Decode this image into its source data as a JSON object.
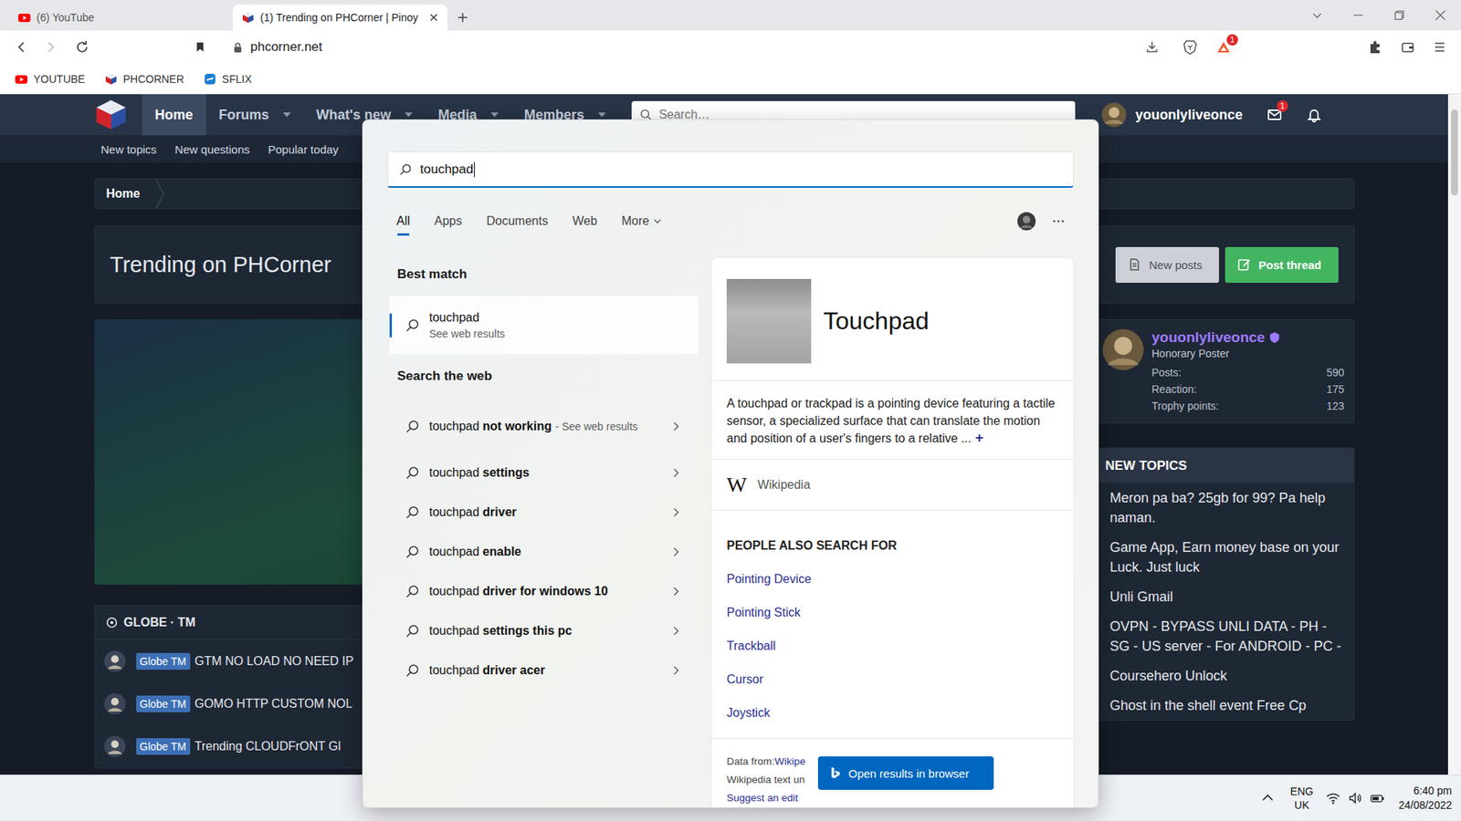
{
  "browser": {
    "tabs": [
      {
        "label": "(6) YouTube",
        "selected": false,
        "kind": "youtube"
      },
      {
        "label": "(1) Trending on PHCorner | Pinoy",
        "selected": true,
        "kind": "phcorner"
      }
    ],
    "forward_enabled": false,
    "url": "phcorner.net",
    "rewards_badge": "1",
    "bookmarks": [
      {
        "label": "YOUTUBE",
        "kind": "youtube"
      },
      {
        "label": "PHCORNER",
        "kind": "phcorner"
      },
      {
        "label": "SFLIX",
        "kind": "sflix"
      }
    ]
  },
  "site": {
    "nav": [
      {
        "label": "Home",
        "selected": true,
        "dropdown": false
      },
      {
        "label": "Forums",
        "selected": false,
        "dropdown": true
      },
      {
        "label": "What's new",
        "selected": false,
        "dropdown": true
      },
      {
        "label": "Media",
        "selected": false,
        "dropdown": true
      },
      {
        "label": "Members",
        "selected": false,
        "dropdown": true
      }
    ],
    "search_placeholder": "Search…",
    "user": "youonlyliveonce",
    "mail_badge": "1",
    "subnav": [
      "New topics",
      "New questions",
      "Popular today"
    ],
    "breadcrumb": "Home",
    "page_title": "Trending on PHCorner",
    "actions": [
      {
        "label": "New posts",
        "kind": "secondary"
      },
      {
        "label": "Post thread",
        "kind": "primary"
      }
    ],
    "section": {
      "title": "GLOBE · TM",
      "threads": [
        {
          "tag": "Globe TM",
          "title": "GTM NO LOAD NO NEED IP"
        },
        {
          "tag": "Globe TM",
          "title": "GOMO HTTP CUSTOM NOL"
        },
        {
          "tag": "Globe TM",
          "title": "Trending CLOUDFrONT Gl"
        }
      ]
    },
    "profile": {
      "name": "youonlyliveonce",
      "rank": "Honorary Poster",
      "stats": [
        {
          "label": "Posts:",
          "value": "590"
        },
        {
          "label": "Reaction:",
          "value": "175"
        },
        {
          "label": "Trophy points:",
          "value": "123"
        }
      ]
    },
    "new_topics": {
      "title": "NEW TOPICS",
      "items": [
        "Meron pa ba? 25gb for 99? Pa help naman.",
        "Game App, Earn money base on your Luck. Just luck",
        "Unli Gmail",
        "OVPN - BYPASS UNLI DATA - PH - SG - US server - For ANDROID - PC -",
        "Coursehero Unlock",
        "Ghost in the shell event Free Cp"
      ]
    }
  },
  "search": {
    "query": "touchpad",
    "filters": [
      {
        "label": "All",
        "selected": true,
        "dropdown": false
      },
      {
        "label": "Apps",
        "selected": false,
        "dropdown": false
      },
      {
        "label": "Documents",
        "selected": false,
        "dropdown": false
      },
      {
        "label": "Web",
        "selected": false,
        "dropdown": false
      },
      {
        "label": "More",
        "selected": false,
        "dropdown": true
      }
    ],
    "best_match": {
      "heading": "Best match",
      "title": "touchpad",
      "subtitle": "See web results",
      "selected": true
    },
    "web": {
      "heading": "Search the web",
      "suggestions": [
        {
          "prefix": "touchpad",
          "bold": "not working",
          "hint": "- See web results"
        },
        {
          "prefix": "touchpad",
          "bold": "settings"
        },
        {
          "prefix": "touchpad",
          "bold": "driver"
        },
        {
          "prefix": "touchpad",
          "bold": "enable"
        },
        {
          "prefix": "touchpad",
          "bold": "driver for windows 10"
        },
        {
          "prefix": "touchpad",
          "bold": "settings this pc"
        },
        {
          "prefix": "touchpad",
          "bold": "driver acer"
        }
      ]
    },
    "preview": {
      "title": "Touchpad",
      "description": "A touchpad or trackpad is a pointing device featuring a tactile sensor, a specialized surface that can translate the motion and position of a user's fingers to a relative ...",
      "expand": "+",
      "source_logo": "W",
      "source": "Wikipedia",
      "related_heading": "PEOPLE ALSO SEARCH FOR",
      "related": [
        "Pointing Device",
        "Pointing Stick",
        "Trackball",
        "Cursor",
        "Joystick"
      ],
      "footer": {
        "data_label": "Data from:",
        "data_link": "Wikipe",
        "license": "Wikipedia text un",
        "suggest": "Suggest an edit"
      }
    },
    "open_button": "Open results in browser"
  },
  "taskbar": {
    "language": "ENG",
    "region": "UK",
    "time": "6:40 pm",
    "date": "24/08/2022"
  }
}
